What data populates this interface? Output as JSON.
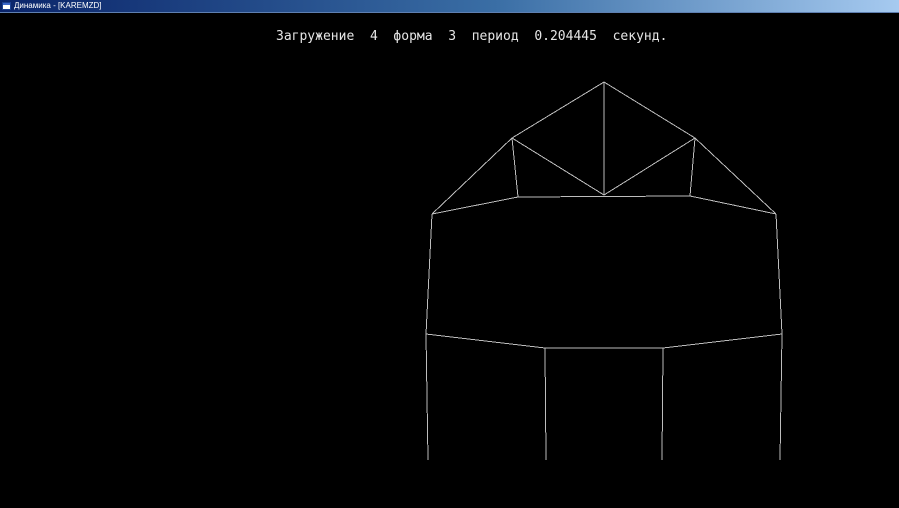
{
  "window": {
    "title": "Динамика - [KAREMZD]"
  },
  "display": {
    "load_label": "Загружение",
    "load_number": "4",
    "mode_label": "форма",
    "mode_number": "3",
    "period_label": "период",
    "period_value": "0.204445",
    "period_unit": "секунд."
  },
  "colors": {
    "background": "#000000",
    "line": "#bdbdbd",
    "text": "#e6e6e6"
  }
}
